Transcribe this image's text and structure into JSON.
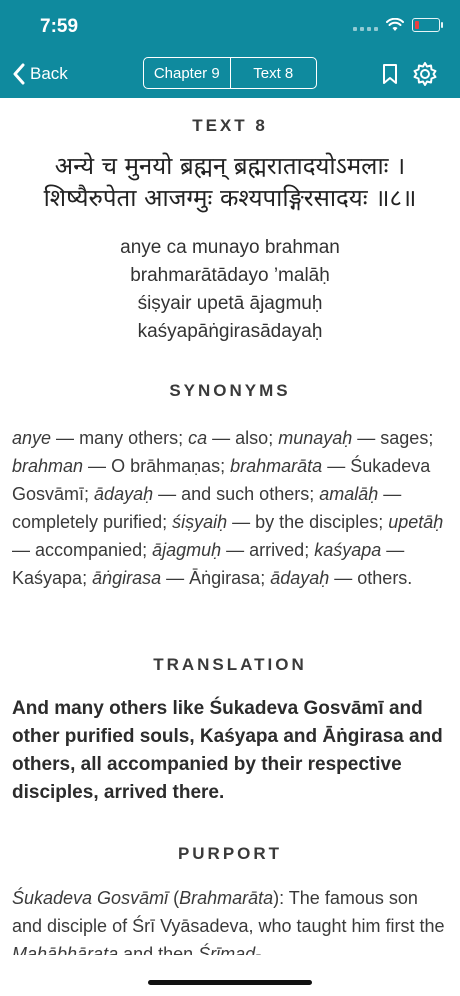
{
  "status": {
    "time": "7:59"
  },
  "nav": {
    "back_label": "Back",
    "chapter_label": "Chapter 9",
    "text_label": "Text 8"
  },
  "verse": {
    "heading": "TEXT 8",
    "devanagari": [
      "अन्ये च मुनयो ब्रह्मन् ब्रह्मरातादयोऽमलाः ।",
      "शिष्यैरुपेता आजग्मुः कश्यपाङ्गिरसादयः ॥८॥"
    ],
    "transliteration": [
      "anye ca munayo brahman",
      "brahmarātādayo ’malāḥ",
      "śiṣyair upetā ājagmuḥ",
      "kaśyapāṅgirasādayaḥ"
    ]
  },
  "synonyms": {
    "heading": "SYNONYMS",
    "items": [
      {
        "word": "anye",
        "meaning": "many others"
      },
      {
        "word": "ca",
        "meaning": "also"
      },
      {
        "word": "munayaḥ",
        "meaning": "sages"
      },
      {
        "word": "brahman",
        "meaning": "O brāhmaṇas"
      },
      {
        "word": "brahmarāta",
        "meaning": "Śukadeva Gosvāmī"
      },
      {
        "word": "ādayaḥ",
        "meaning": "and such others"
      },
      {
        "word": "amalāḥ",
        "meaning": "completely purified"
      },
      {
        "word": "śiṣyaiḥ",
        "meaning": "by the disciples"
      },
      {
        "word": "upetāḥ",
        "meaning": "accompanied"
      },
      {
        "word": "ājagmuḥ",
        "meaning": "arrived"
      },
      {
        "word": "kaśyapa",
        "meaning": "Kaśyapa"
      },
      {
        "word": "āṅgirasa",
        "meaning": "Āṅgirasa"
      },
      {
        "word": "ādayaḥ",
        "meaning": "others."
      }
    ]
  },
  "translation": {
    "heading": "TRANSLATION",
    "text": "And many others like Śukadeva Gosvāmī and other purified souls, Kaśyapa and Āṅgirasa and others, all accompanied by their respective disciples, arrived there."
  },
  "purport": {
    "heading": "PURPORT",
    "seg1_italic": "Śukadeva Gosvāmī",
    "seg2": " (",
    "seg3_italic": "Brahmarāta",
    "seg4": "): The famous son and disciple of Śrī Vyāsadeva, who taught him first the ",
    "seg5_italic": "Mahābhārata",
    "seg6": " and then ",
    "seg7_italic": "Śrīmad-"
  },
  "colors": {
    "header_bg": "#0f8a9e",
    "header_text": "#ffffff"
  },
  "icons": [
    "back-chevron-icon",
    "bookmark-icon",
    "gear-icon",
    "wifi-icon",
    "battery-icon"
  ]
}
